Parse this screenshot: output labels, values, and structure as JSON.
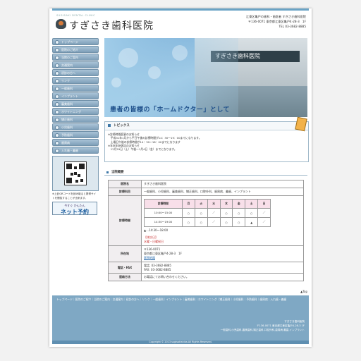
{
  "header": {
    "logo_sub": "SUGISAKI DENTAL CLINIC",
    "logo_text": "すぎさき歯科医院",
    "tagline": "江東区亀戸の歯科・歯医者 すぎさき歯科医院",
    "address": "〒136-0071 東京都江東区亀戸4-28-3　1F",
    "tel": "TEL 03-3682-8885"
  },
  "sidebar": {
    "items": [
      {
        "label": "トップページ"
      },
      {
        "label": "医院のご紹介"
      },
      {
        "label": "当院のご案内"
      },
      {
        "label": "交通案内"
      },
      {
        "label": "初診の方へ"
      },
      {
        "label": "リンク"
      },
      {
        "label": "一般歯科"
      },
      {
        "label": "インプラント"
      },
      {
        "label": "審美歯科"
      },
      {
        "label": "ホワイトニング"
      },
      {
        "label": "矯正歯科"
      },
      {
        "label": "小児歯科"
      },
      {
        "label": "予防歯科"
      },
      {
        "label": "歯周病"
      },
      {
        "label": "入れ歯・義歯"
      }
    ],
    "qr_caption": "※上記QRコードを読み取ると携帯サイトを閲覧することが出来ます。",
    "net_small": "今すぐ かんたん",
    "net_big": "ネット予約"
  },
  "hero": {
    "sign": "すぎさき歯科医院",
    "caption": "患者の皆様の「ホームドクター」として"
  },
  "topics": {
    "title": "トピックス",
    "lines": [
      "※診療時間変更のお知らせ",
      "　平成31年1月から平日午後の診療時間が14：30〜19：00までになります。",
      "　土曜日午後の診療時間が14：30〜18：00までになります",
      "※年末年始休診のお知らせ",
      "　12月29日（土）午後〜1月4日（金）までになります。"
    ]
  },
  "info": {
    "section_title": "当院概要",
    "rows": {
      "name_label": "医院名",
      "name_value": "すぎさき歯科医院",
      "subjects_label": "診療科目",
      "subjects_value": "一般歯科、小児歯科、審美歯科、矯正歯科、口腔外科、歯周病、義歯、インプラント",
      "hours_label": "診療時間",
      "location_label": "所在地",
      "phone_label": "電話・FAX",
      "payment_label": "連絡方法"
    },
    "hours_table": {
      "headers": [
        "診療時間",
        "月",
        "火",
        "水",
        "木",
        "金",
        "土",
        "日"
      ],
      "row1": [
        "10:00〜15:00",
        "○",
        "○",
        "／",
        "○",
        "○",
        "○",
        "／"
      ],
      "row2": [
        "14:30〜19:00",
        "○",
        "○",
        "／",
        "○",
        "○",
        "▲",
        "／"
      ]
    },
    "hours_note": "▲…14:30〜18:00",
    "holiday_title": "【休診日】",
    "holiday_text": "水曜・日曜祝日",
    "postal": "〒136-0071",
    "address_line": "東京都江東区亀戸4-28-3　1F",
    "map_link": "医院地図",
    "tel": "電話: 03-3682-8885",
    "fax": "FAX: 03-3682-8885",
    "contact": "お電話にてお問い合わせください。"
  },
  "pagetop": "▲Top",
  "footer": {
    "links": "トップページ｜医院のご紹介｜当院のご案内｜交通案内｜初診の方へ｜リンク｜一般歯科｜インプラント｜審美歯科｜ホワイトニング｜矯正歯科｜小児歯科｜予防歯科｜歯周病｜入れ歯・義歯",
    "name": "すぎさき歯科医院",
    "address": "〒136-0071 東京都江東区亀戸4-28-3 1F",
    "subjects": "一般歯科,小児歯科,審美歯科,矯正歯科,口腔外科,歯周病,義歯,インプラント",
    "copyright": "Copyright © 2013 sugisakishika.All Rights Reserved."
  }
}
